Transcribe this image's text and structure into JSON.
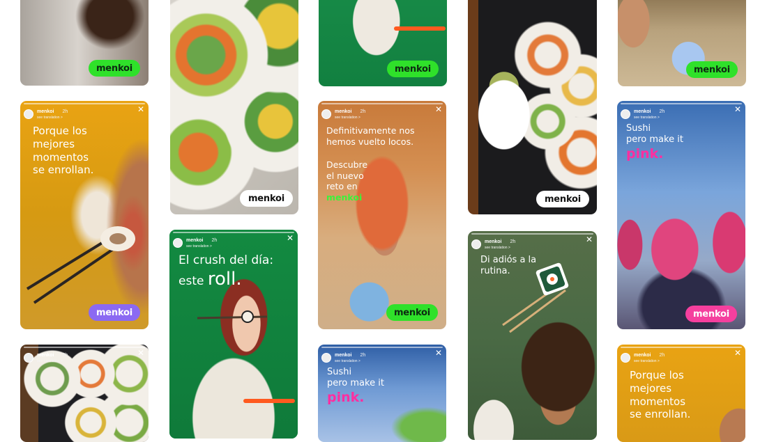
{
  "brand": "menkoi",
  "story": {
    "username": "menkoi",
    "time": "2h",
    "see_translation": "see translation >",
    "close_glyph": "✕"
  },
  "captions": {
    "porque_lines": [
      "Porque los",
      "mejores",
      "momentos",
      "se enrollan."
    ],
    "def_lines": [
      "Definitivamente nos",
      "hemos vuelto locos."
    ],
    "descubre_lines": [
      "Descubre",
      "el nuevo",
      "reto en"
    ],
    "descubre_brand": "menkoi",
    "crush_line1": "El crush del día:",
    "crush_line2a": "este ",
    "crush_line2b": "roll.",
    "sushi_lines": [
      "Sushi",
      "pero make it"
    ],
    "sushi_pink": "pink.",
    "adios_lines": [
      "Di adiós a la",
      "rutina."
    ]
  },
  "colors": {
    "logo_green": "#2fe12a",
    "logo_purple": "#8b69f2",
    "logo_pink": "#f53f9e",
    "accent_pink_text": "#ff2ea0",
    "accent_green_text": "#3df23a"
  }
}
